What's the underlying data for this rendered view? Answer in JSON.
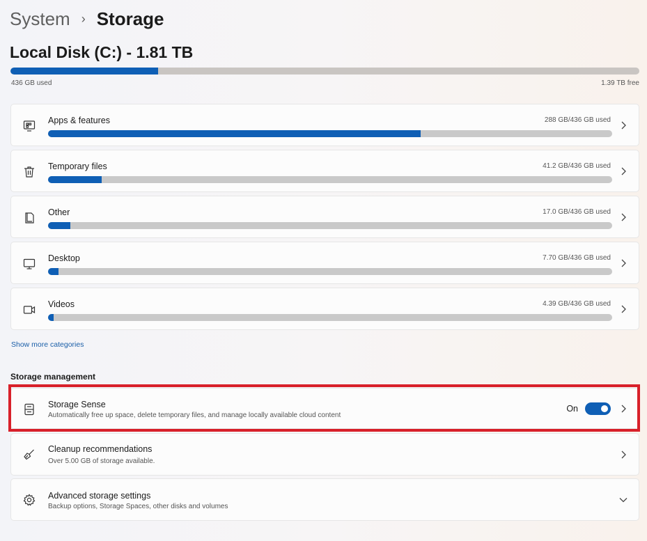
{
  "breadcrumb": {
    "parent": "System",
    "current": "Storage"
  },
  "disk": {
    "title": "Local Disk (C:) - 1.81 TB",
    "used_label": "436 GB used",
    "free_label": "1.39 TB free",
    "used_fraction": 0.235
  },
  "categories": [
    {
      "name": "Apps & features",
      "usage": "288 GB/436 GB used",
      "fraction": 0.661,
      "icon": "apps-icon"
    },
    {
      "name": "Temporary files",
      "usage": "41.2 GB/436 GB used",
      "fraction": 0.095,
      "icon": "trash-icon"
    },
    {
      "name": "Other",
      "usage": "17.0 GB/436 GB used",
      "fraction": 0.039,
      "icon": "document-icon"
    },
    {
      "name": "Desktop",
      "usage": "7.70 GB/436 GB used",
      "fraction": 0.018,
      "icon": "monitor-icon"
    },
    {
      "name": "Videos",
      "usage": "4.39 GB/436 GB used",
      "fraction": 0.01,
      "icon": "video-icon"
    }
  ],
  "show_more": "Show more categories",
  "management": {
    "title": "Storage management",
    "storage_sense": {
      "name": "Storage Sense",
      "desc": "Automatically free up space, delete temporary files, and manage locally available cloud content",
      "toggle_label": "On",
      "toggle_on": true,
      "icon": "storage-drive-icon"
    },
    "cleanup": {
      "name": "Cleanup recommendations",
      "desc": "Over 5.00 GB of storage available.",
      "icon": "broom-icon"
    },
    "advanced": {
      "name": "Advanced storage settings",
      "desc": "Backup options, Storage Spaces, other disks and volumes",
      "icon": "gear-icon"
    }
  },
  "colors": {
    "accent": "#0f5fb5",
    "highlight": "#d8202a",
    "bar_track": "#c9c9c9"
  }
}
